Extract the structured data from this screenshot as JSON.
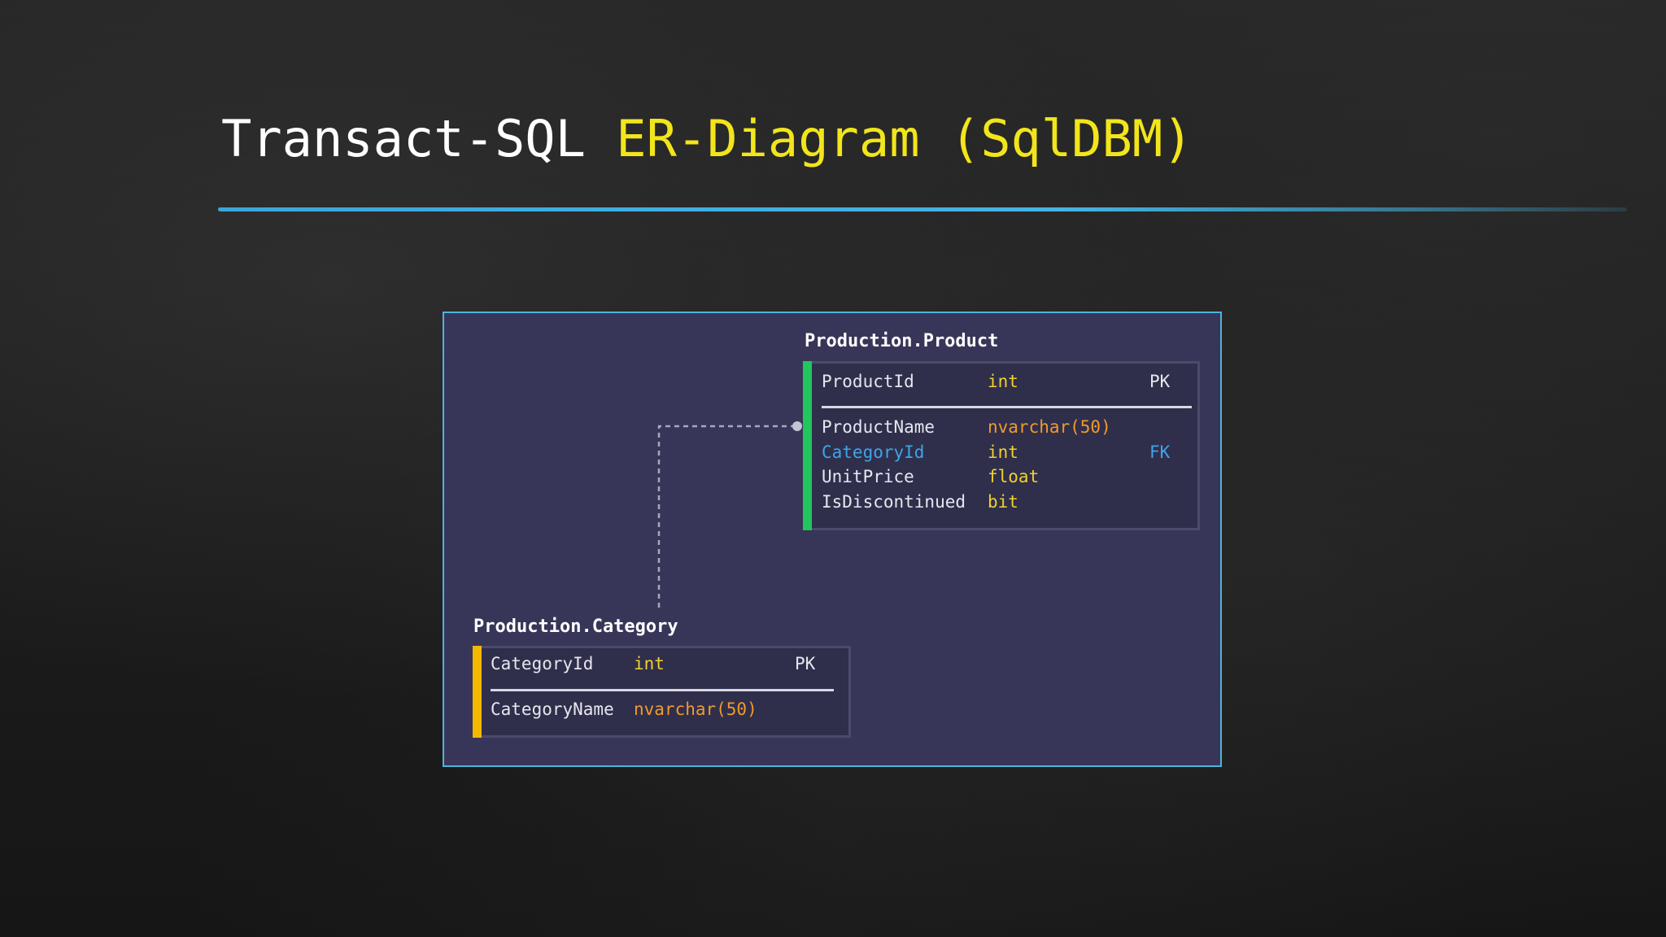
{
  "slide": {
    "title_part_1": "Transact-SQL",
    "title_part_2": "ER-Diagram (SqlDBM)"
  },
  "colors": {
    "title_white": "#ffffff",
    "title_yellow": "#f2e51b",
    "rule_blue": "#45b4e2",
    "canvas_bg": "#373658",
    "product_accent": "#22c55e",
    "category_accent": "#f5b800",
    "fk_blue": "#3ea5e8",
    "type_yellow": "#f2d02a",
    "type_orange": "#f09a2a"
  },
  "diagram": {
    "product": {
      "title": "Production.Product",
      "pk": {
        "name": "ProductId",
        "type": "int",
        "key": "PK"
      },
      "columns": [
        {
          "name": "ProductName",
          "type": "nvarchar(50)",
          "key": ""
        },
        {
          "name": "CategoryId",
          "type": "int",
          "key": "FK"
        },
        {
          "name": "UnitPrice",
          "type": "float",
          "key": ""
        },
        {
          "name": "IsDiscontinued",
          "type": "bit",
          "key": ""
        }
      ]
    },
    "category": {
      "title": "Production.Category",
      "pk": {
        "name": "CategoryId",
        "type": "int",
        "key": "PK"
      },
      "columns": [
        {
          "name": "CategoryName",
          "type": "nvarchar(50)",
          "key": ""
        }
      ]
    }
  }
}
